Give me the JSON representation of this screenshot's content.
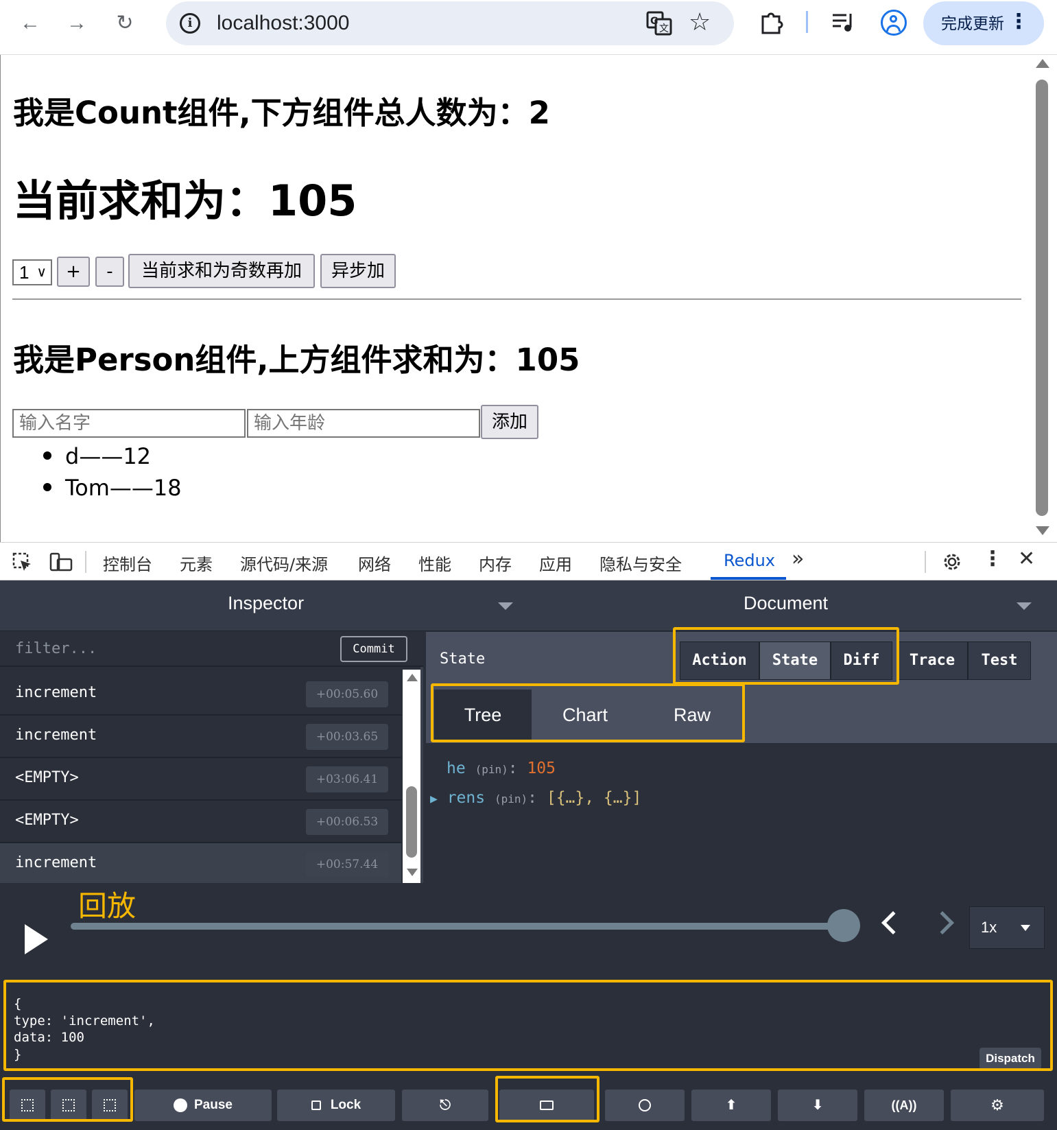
{
  "browser": {
    "url": "localhost:3000",
    "update_button": "完成更新"
  },
  "page": {
    "count_title": "我是Count组件,下方组件总人数为：2",
    "sum_title": "当前求和为：105",
    "select_value": "1",
    "buttons": {
      "plus": "+",
      "minus": "-",
      "odd_add": "当前求和为奇数再加",
      "async_add": "异步加"
    },
    "person_title": "我是Person组件,上方组件求和为：105",
    "name_placeholder": "输入名字",
    "age_placeholder": "输入年龄",
    "add_button": "添加",
    "persons": [
      {
        "text": "d——12"
      },
      {
        "text": "Tom——18"
      }
    ]
  },
  "devtools": {
    "tabs": [
      "控制台",
      "元素",
      "源代码/来源",
      "网络",
      "性能",
      "内存",
      "应用",
      "隐私与安全"
    ],
    "active_tab": "Redux",
    "more": "»"
  },
  "redux": {
    "inspector_title": "Inspector",
    "document_title": "Document",
    "filter_placeholder": "filter...",
    "commit_label": "Commit",
    "actions": [
      {
        "name": "increment",
        "time": "+00:05.60"
      },
      {
        "name": "increment",
        "time": "+00:03.65"
      },
      {
        "name": "<EMPTY>",
        "time": "+03:06.41"
      },
      {
        "name": "<EMPTY>",
        "time": "+00:06.53"
      },
      {
        "name": "increment",
        "time": "+00:57.44"
      }
    ],
    "state_label": "State",
    "monitor_tabs": [
      "Action",
      "State",
      "Diff",
      "Trace",
      "Test"
    ],
    "active_monitor_tab": "State",
    "view_tabs": [
      "Tree",
      "Chart",
      "Raw"
    ],
    "active_view_tab": "Tree",
    "tree": {
      "he_key": "he",
      "pin": "(pin)",
      "he_value": "105",
      "rens_key": "rens",
      "rens_value": "[{…}, {…}]"
    },
    "replay_annotation": "回放",
    "slider_position": 1.0,
    "speed": "1x",
    "dispatch_code": "{\ntype: 'increment',\ndata: 100\n}",
    "dispatch_label": "Dispatch",
    "toolbar": {
      "pause": "Pause",
      "lock": "Lock"
    }
  },
  "colors": {
    "highlight": "#f5b700",
    "redux_bg": "#2b2f3a",
    "accent_blue": "#0b57d0",
    "number": "#e2702e",
    "key": "#6fb3d2"
  }
}
